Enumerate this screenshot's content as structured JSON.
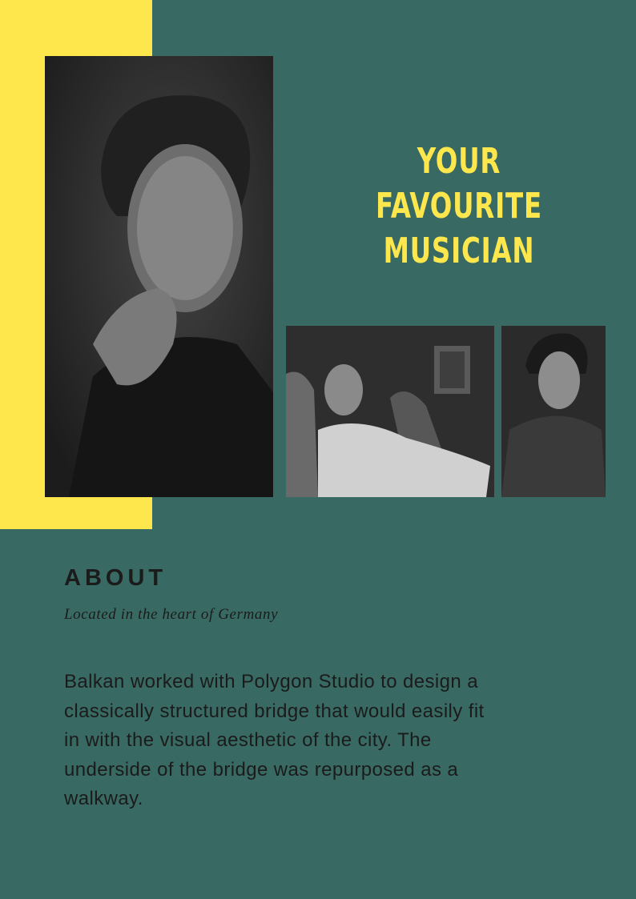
{
  "page": {
    "title": "YOUR FAVOURITE MUSICIAN",
    "colors": {
      "background": "#386a63",
      "accent": "#fde74c",
      "text": "#1b1b1b"
    }
  },
  "photos": [
    {
      "name": "portrait-hand-on-chin-photo"
    },
    {
      "name": "musician-in-armchair-photo"
    },
    {
      "name": "musician-portrait-photo"
    }
  ],
  "about": {
    "heading": "ABOUT",
    "subtitle": "Located in the heart of Germany",
    "body": "Balkan worked with Polygon Studio to design a classically structured bridge that would easily fit in with the visual aesthetic of the city. The underside of the bridge was repurposed as a walkway."
  }
}
